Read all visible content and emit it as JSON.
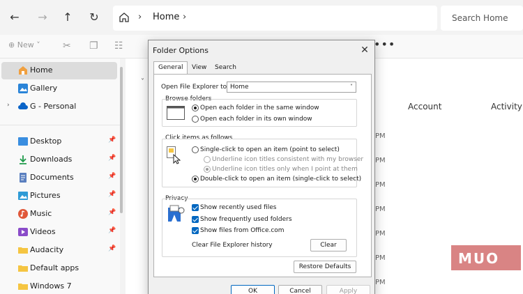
{
  "explorer": {
    "address": {
      "crumb": "Home"
    },
    "search": {
      "placeholder": "Search Home"
    },
    "toolbar": {
      "new_label": "New",
      "more": "•••"
    },
    "sidebar": {
      "items": [
        {
          "label": "Home",
          "icon": "home-icon"
        },
        {
          "label": "Gallery",
          "icon": "gallery-icon"
        },
        {
          "label": "G - Personal",
          "icon": "cloud-icon"
        },
        {
          "label": "Desktop",
          "icon": "desktop-icon"
        },
        {
          "label": "Downloads",
          "icon": "download-icon"
        },
        {
          "label": "Documents",
          "icon": "documents-icon"
        },
        {
          "label": "Pictures",
          "icon": "pictures-icon"
        },
        {
          "label": "Music",
          "icon": "music-icon"
        },
        {
          "label": "Videos",
          "icon": "videos-icon"
        },
        {
          "label": "Audacity",
          "icon": "folder-icon"
        },
        {
          "label": "Default apps",
          "icon": "folder-icon"
        },
        {
          "label": "Windows 7",
          "icon": "folder-icon"
        }
      ]
    },
    "columns": {
      "account": "Account",
      "activity": "Activity"
    },
    "time_suffix": "PM"
  },
  "dialog": {
    "title": "Folder Options",
    "tabs": [
      "General",
      "View",
      "Search"
    ],
    "open_to_label": "Open File Explorer to:",
    "open_to_value": "Home",
    "browse": {
      "title": "Browse folders",
      "same_window": "Open each folder in the same window",
      "own_window": "Open each folder in its own window"
    },
    "click": {
      "title": "Click items as follows",
      "single": "Single-click to open an item (point to select)",
      "underline_consistent": "Underline icon titles consistent with my browser",
      "underline_point": "Underline icon titles only when I point at them",
      "double": "Double-click to open an item (single-click to select)"
    },
    "privacy": {
      "title": "Privacy",
      "recent_files": "Show recently used files",
      "frequent_folders": "Show frequently used folders",
      "office_files": "Show files from Office.com",
      "clear_history": "Clear File Explorer history",
      "clear_button": "Clear"
    },
    "restore_defaults": "Restore Defaults",
    "ok": "OK",
    "cancel": "Cancel",
    "apply": "Apply"
  },
  "watermark": {
    "text": "MUO"
  }
}
